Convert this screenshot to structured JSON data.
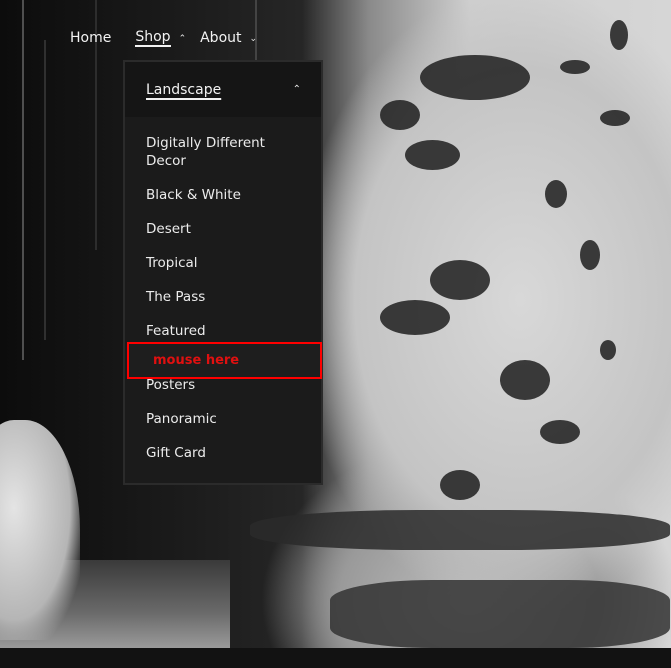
{
  "nav": {
    "items": [
      {
        "label": "Home",
        "active": false
      },
      {
        "label": "Shop",
        "active": true,
        "expanded": true,
        "icon": "chevron-up-icon"
      },
      {
        "label": "About",
        "active": false,
        "expanded": false,
        "icon": "chevron-down-icon"
      }
    ]
  },
  "dropdown": {
    "header": {
      "label": "Landscape",
      "icon": "chevron-up-icon"
    },
    "items": [
      "Digitally Different Decor",
      "Black & White",
      "Desert",
      "Tropical",
      "The Pass",
      "Featured",
      "Posters",
      "Panoramic",
      "Gift Card"
    ]
  },
  "annotation": {
    "text": "mouse here",
    "color": "#ff0000"
  },
  "colors": {
    "panel_bg": "#1b1b1b",
    "panel_header_bg": "#151515",
    "text": "#f2f2f2"
  }
}
